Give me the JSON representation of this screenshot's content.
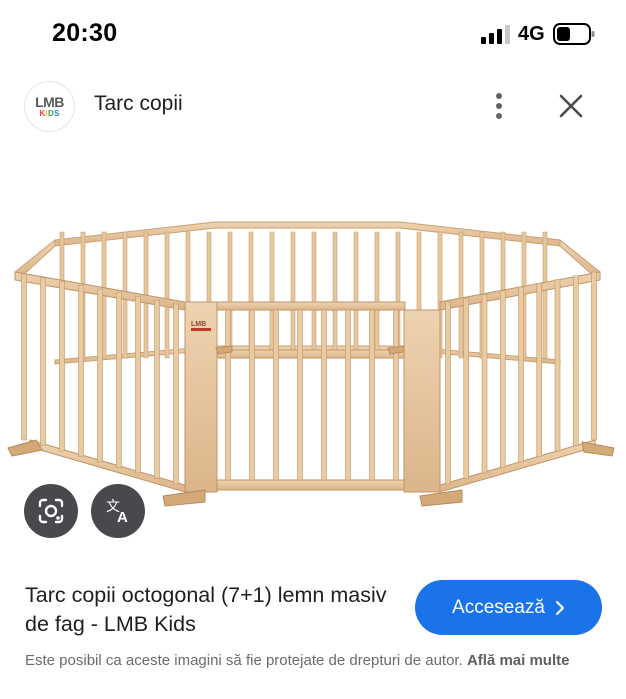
{
  "status_bar": {
    "time": "20:30",
    "network": "4G",
    "icons": [
      "signal-icon",
      "battery-icon"
    ]
  },
  "header": {
    "logo": {
      "line1": "LMB",
      "line2": "KIDS"
    },
    "title": "Tarc copii",
    "icons": [
      "more-vert-icon",
      "close-icon"
    ]
  },
  "image": {
    "label": "LMB",
    "wood_color": "#e8c9a3",
    "icons": [
      "google-lens-icon",
      "translate-icon"
    ]
  },
  "result": {
    "title": "Tarc copii octogonal (7+1) lemn masiv de fag - LMB Kids",
    "visit_label": "Accesează",
    "copyright_text": "Este posibil ca aceste imagini să fie protejate de drepturi de autor.",
    "learn_more": "Află mai multe"
  },
  "colors": {
    "accent": "#1a73e8",
    "text_primary": "#1f1f1f",
    "text_secondary": "#6b6b6b"
  }
}
